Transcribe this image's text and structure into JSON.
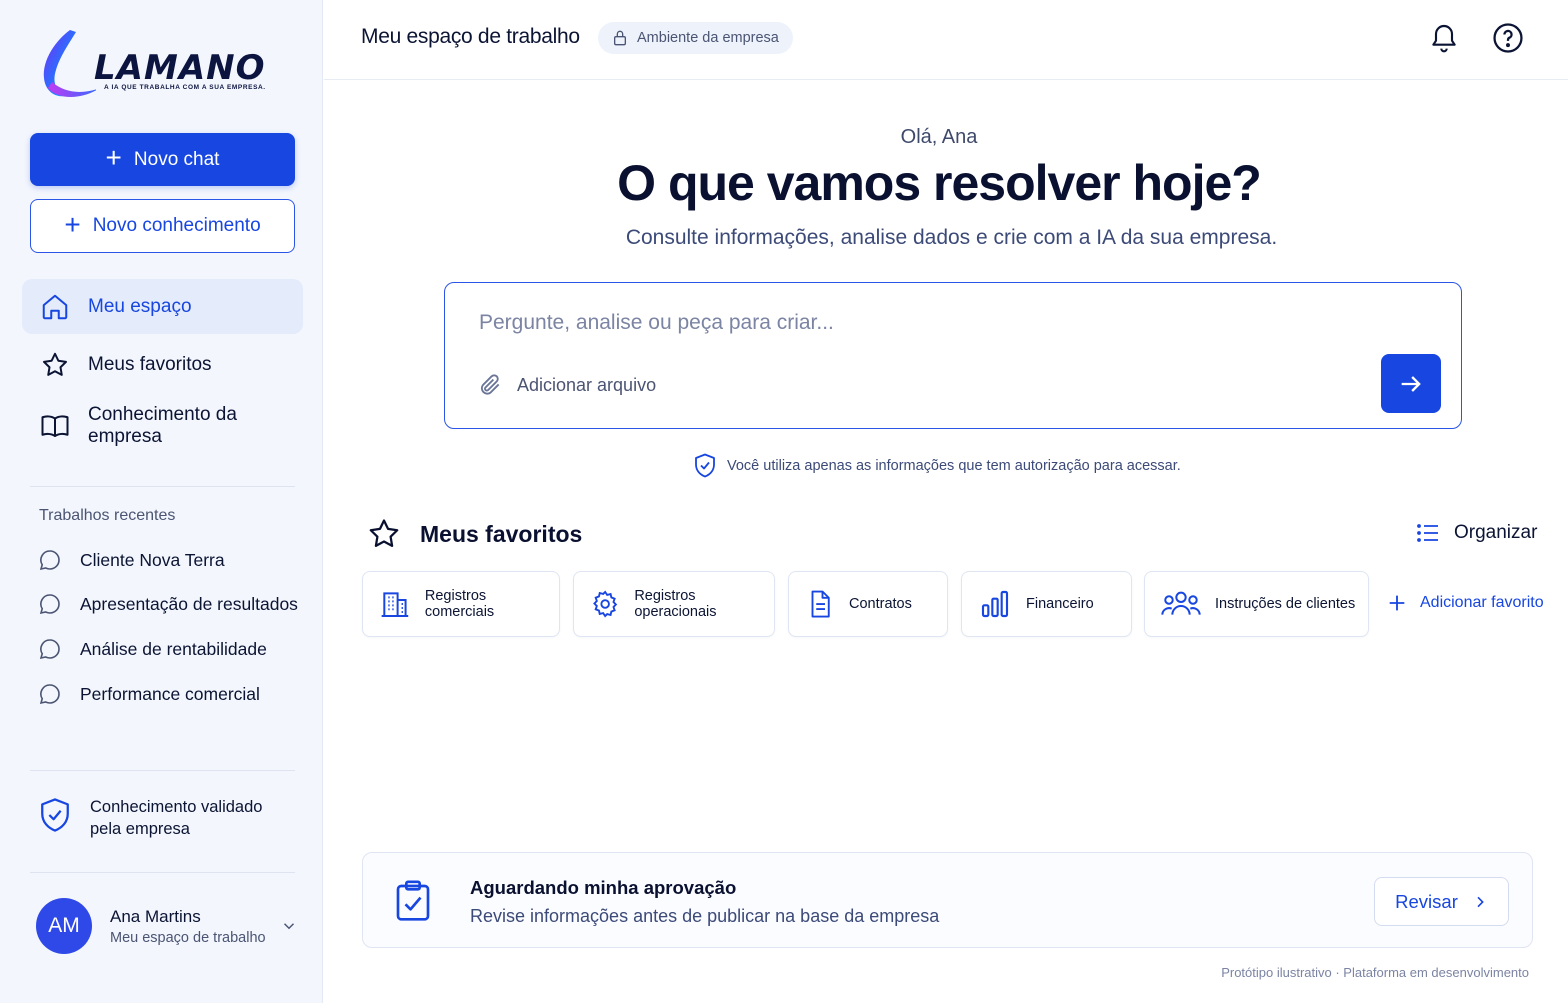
{
  "brand": {
    "name": "LAMANO",
    "tagline": "A IA QUE TRABALHA COM A SUA EMPRESA."
  },
  "sidebar": {
    "new_chat": "Novo chat",
    "new_knowledge": "Novo conhecimento",
    "nav": [
      {
        "label": "Meu espaço",
        "icon": "home-icon",
        "active": true
      },
      {
        "label": "Meus favoritos",
        "icon": "star-icon",
        "active": false
      },
      {
        "label": "Conhecimento da empresa",
        "icon": "book-icon",
        "active": false
      }
    ],
    "recent_title": "Trabalhos recentes",
    "recent": [
      "Cliente Nova Terra",
      "Apresentação de resultados",
      "Análise de rentabilidade",
      "Performance comercial"
    ],
    "validated": "Conhecimento validado pela empresa",
    "user": {
      "initials": "AM",
      "name": "Ana Martins",
      "subtitle": "Meu espaço de trabalho"
    }
  },
  "header": {
    "title": "Meu espaço de trabalho",
    "badge": "Ambiente da empresa",
    "icons": [
      "bell-icon",
      "help-icon"
    ]
  },
  "main": {
    "greeting": "Olá, Ana",
    "headline": "O que vamos resolver hoje?",
    "subline": "Consulte informações, analise dados e crie com a IA da sua empresa.",
    "prompt": {
      "placeholder": "Pergunte, analise ou peça para criar...",
      "attach": "Adicionar arquivo"
    },
    "privacy": "Você utiliza apenas as informações que tem autorização para acessar.",
    "favorites": {
      "title": "Meus favoritos",
      "organize": "Organizar",
      "items": [
        {
          "label": "Registros comerciais",
          "icon": "building-icon"
        },
        {
          "label": "Registros operacionais",
          "icon": "gear-icon"
        },
        {
          "label": "Contratos",
          "icon": "document-icon"
        },
        {
          "label": "Financeiro",
          "icon": "bar-chart-icon"
        },
        {
          "label": "Instruções de clientes",
          "icon": "users-icon"
        }
      ],
      "add": "Adicionar favorito"
    },
    "approval": {
      "title": "Aguardando minha aprovação",
      "subtitle": "Revise informações antes de publicar na base da empresa",
      "action": "Revisar"
    },
    "footnote": "Protótipo ilustrativo · Plataforma em desenvolvimento"
  },
  "colors": {
    "primary": "#1746e0",
    "sidebar_bg": "#f3f6fd",
    "text_dark": "#0a1130"
  }
}
